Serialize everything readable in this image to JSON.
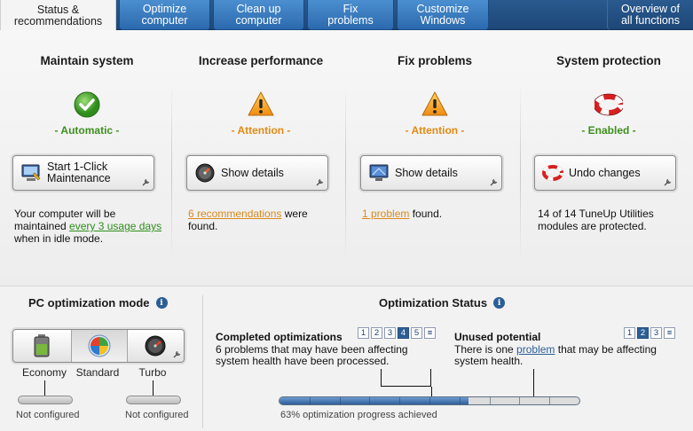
{
  "tabs": [
    {
      "label": "Status &\nrecommendations"
    },
    {
      "label": "Optimize\ncomputer"
    },
    {
      "label": "Clean up\ncomputer"
    },
    {
      "label": "Fix\nproblems"
    },
    {
      "label": "Customize\nWindows"
    },
    {
      "label": "Overview of\nall functions"
    }
  ],
  "columns": [
    {
      "title": "Maintain system",
      "status": "- Automatic -",
      "status_type": "ok",
      "icon": "check-shield-icon",
      "button": "Start 1-Click\nMaintenance",
      "desc_pre": "Your computer will be maintained ",
      "desc_link": "every 3 usage days",
      "desc_post": " when in idle mode."
    },
    {
      "title": "Increase performance",
      "status": "- Attention -",
      "status_type": "warn",
      "icon": "warning-icon",
      "button": "Show details",
      "desc_pre": "",
      "desc_link": "6 recommendations",
      "desc_post": " were found."
    },
    {
      "title": "Fix problems",
      "status": "- Attention -",
      "status_type": "warn",
      "icon": "warning-icon",
      "button": "Show details",
      "desc_pre": "",
      "desc_link": "1 problem",
      "desc_post": " found."
    },
    {
      "title": "System protection",
      "status": "- Enabled -",
      "status_type": "ok",
      "icon": "lifebuoy-icon",
      "button": "Undo changes",
      "desc_pre": "14 of 14 TuneUp Utilities modules are protected.",
      "desc_link": "",
      "desc_post": ""
    }
  ],
  "pc_mode": {
    "title": "PC optimization mode",
    "modes": [
      "Economy",
      "Standard",
      "Turbo"
    ],
    "selected": "Standard",
    "economy_status": "Not configured",
    "turbo_status": "Not configured"
  },
  "opt_status": {
    "title": "Optimization Status",
    "completed": {
      "title": "Completed optimizations",
      "text": "6 problems that may have been affecting system health have been processed.",
      "pages": [
        "1",
        "2",
        "3",
        "4",
        "5"
      ],
      "selected_page": "4"
    },
    "unused": {
      "title": "Unused potential",
      "text_pre": "There is one ",
      "link": "problem",
      "text_post": " that may be affecting system health.",
      "pages": [
        "1",
        "2",
        "3"
      ],
      "selected_page": "2"
    },
    "progress": 0.63,
    "progress_text": "63% optimization progress achieved"
  },
  "colors": {
    "accent": "#2c5e96",
    "ok": "#3e8f1e",
    "warn": "#e38a12"
  }
}
